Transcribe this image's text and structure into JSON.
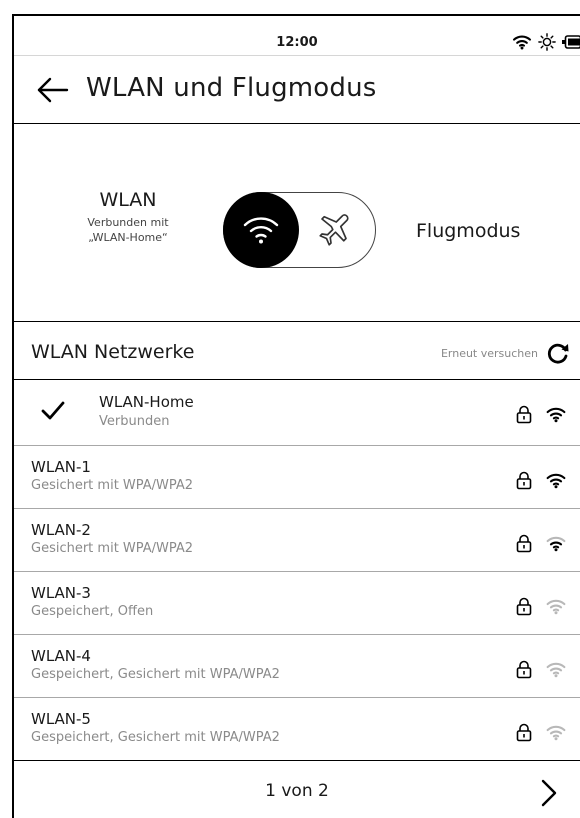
{
  "status_bar": {
    "time": "12:00"
  },
  "header": {
    "title": "WLAN und Flugmodus"
  },
  "mode": {
    "wlan_label": "WLAN",
    "wlan_sub_line1": "Verbunden mit",
    "wlan_sub_line2": "„WLAN-Home“",
    "airplane_label": "Flugmodus",
    "selected": "WLAN"
  },
  "networks": {
    "title": "WLAN Netzwerke",
    "retry_label": "Erneut versuchen",
    "items": [
      {
        "name": "WLAN-Home",
        "status": "Verbunden",
        "connected": true,
        "secured": true,
        "signal_bars": 3
      },
      {
        "name": "WLAN-1",
        "status": "Gesichert mit WPA/WPA2",
        "connected": false,
        "secured": true,
        "signal_bars": 3
      },
      {
        "name": "WLAN-2",
        "status": "Gesichert mit WPA/WPA2",
        "connected": false,
        "secured": true,
        "signal_bars": 2
      },
      {
        "name": "WLAN-3",
        "status": "Gespeichert, Offen",
        "connected": false,
        "secured": true,
        "signal_bars": 1
      },
      {
        "name": "WLAN-4",
        "status": "Gespeichert, Gesichert mit WPA/WPA2",
        "connected": false,
        "secured": true,
        "signal_bars": 1
      },
      {
        "name": "WLAN-5",
        "status": "Gespeichert, Gesichert mit WPA/WPA2",
        "connected": false,
        "secured": true,
        "signal_bars": 1
      }
    ]
  },
  "pagination": {
    "label": "1 von 2"
  },
  "colors": {
    "accent": "#000000",
    "secondary_text": "#8a8a8a",
    "divider": "#a8a8a8",
    "wifi_inactive": "#b8b8b8"
  },
  "icons": [
    "back-arrow-icon",
    "wifi-icon",
    "airplane-icon",
    "refresh-icon",
    "checkmark-icon",
    "lock-icon",
    "wifi-signal-icon",
    "brightness-icon",
    "battery-icon",
    "chevron-right-icon"
  ]
}
